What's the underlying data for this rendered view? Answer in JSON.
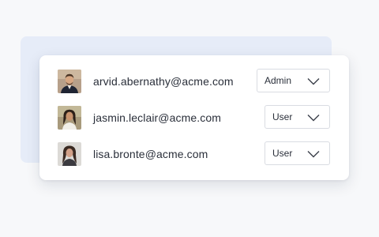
{
  "users": [
    {
      "email": "arvid.abernathy@acme.com",
      "role": "Admin",
      "avatar_icon": "man-portrait-icon"
    },
    {
      "email": "jasmin.leclair@acme.com",
      "role": "User",
      "avatar_icon": "woman-portrait-icon"
    },
    {
      "email": "lisa.bronte@acme.com",
      "role": "User",
      "avatar_icon": "woman-portrait-icon"
    }
  ],
  "colors": {
    "backdrop": "#e6ecf8",
    "card": "#ffffff",
    "text": "#2a2f3a",
    "border": "#d9dce2"
  }
}
